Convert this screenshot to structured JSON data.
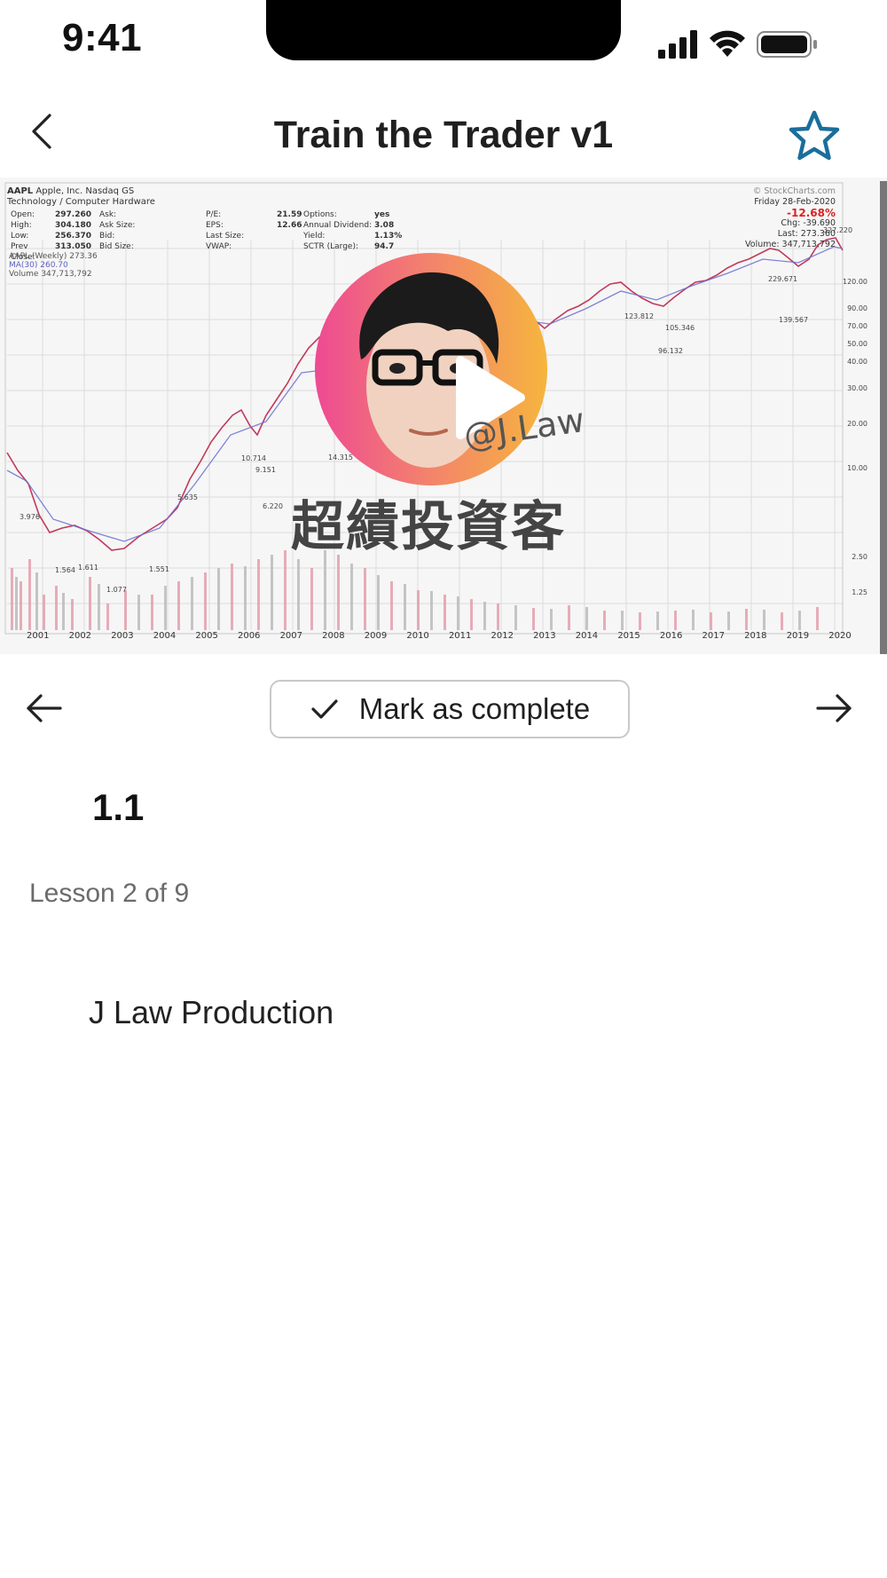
{
  "status_bar": {
    "time": "9:41",
    "icons": [
      "signal-icon",
      "wifi-icon",
      "battery-icon"
    ]
  },
  "header": {
    "title": "Train the Trader v1",
    "back_icon": "chevron-left-icon",
    "favorite_icon": "star-outline-icon",
    "accent_color": "#1a6e9c"
  },
  "video": {
    "play_icon": "play-icon",
    "chart_header": {
      "symbol": "AAPL",
      "company": "Apple, Inc. Nasdaq GS",
      "sector": "Technology / Computer Hardware",
      "source": "© StockCharts.com",
      "date": "Friday 28-Feb-2020",
      "change_pct": "-12.68%",
      "chg": "Chg: -39.690",
      "last": "Last: 273.360",
      "volume": "Volume: 347,713,792",
      "stats": [
        [
          "Open:",
          "297.260",
          "Ask:",
          "",
          "P/E:",
          "21.59",
          "Options:",
          "yes"
        ],
        [
          "High:",
          "304.180",
          "Ask Size:",
          "",
          "EPS:",
          "12.66",
          "Annual Dividend:",
          "3.08"
        ],
        [
          "Low:",
          "256.370",
          "Bid:",
          "",
          "Last Size:",
          "",
          "Yield:",
          "1.13%"
        ],
        [
          "Prev Close:",
          "313.050",
          "Bid Size:",
          "",
          "VWAP:",
          "",
          "SCTR (Large):",
          "94.7"
        ]
      ],
      "legend": [
        "AAPL (Weekly) 273.36",
        "MA(30) 260.70",
        "Volume 347,713,792"
      ]
    },
    "years": [
      "2001",
      "2002",
      "2003",
      "2004",
      "2005",
      "2006",
      "2007",
      "2008",
      "2009",
      "2010",
      "2011",
      "2012",
      "2013",
      "2014",
      "2015",
      "2016",
      "2017",
      "2018",
      "2019",
      "2020"
    ],
    "watermark_handle": "@J.Law",
    "watermark_brand": "超績投資客"
  },
  "lesson_nav": {
    "prev_icon": "arrow-left-icon",
    "next_icon": "arrow-right-icon",
    "complete_label": "Mark as complete",
    "check_icon": "check-icon"
  },
  "lesson": {
    "title": "1.1",
    "meta": "Lesson 2 of 9",
    "author": "J Law Production"
  }
}
